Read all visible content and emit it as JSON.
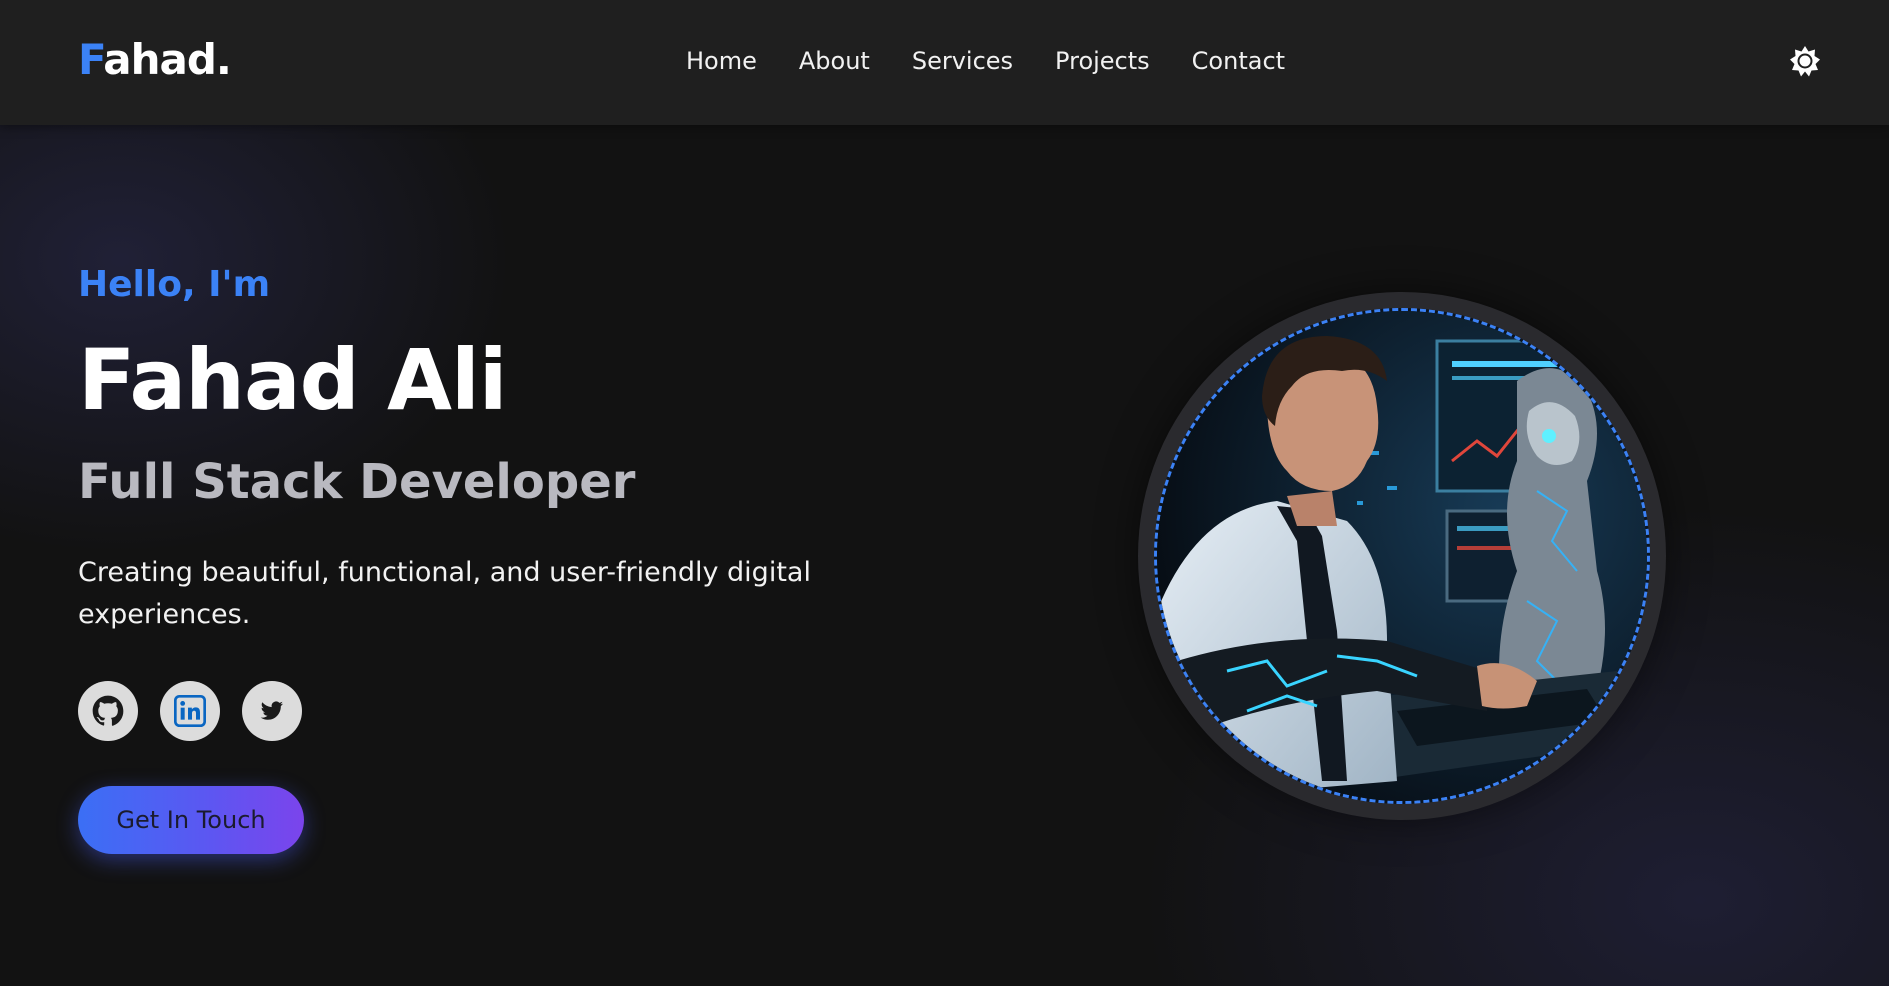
{
  "header": {
    "logo_first": "F",
    "logo_rest": "ahad.",
    "nav": [
      {
        "label": "Home"
      },
      {
        "label": "About"
      },
      {
        "label": "Services"
      },
      {
        "label": "Projects"
      },
      {
        "label": "Contact"
      }
    ],
    "theme_icon": "sun-icon"
  },
  "hero": {
    "greeting": "Hello, I'm",
    "name": "Fahad Ali",
    "role": "Full Stack Developer",
    "description": "Creating beautiful, functional, and user-friendly digital experiences.",
    "socials": [
      {
        "icon": "github-icon"
      },
      {
        "icon": "linkedin-icon"
      },
      {
        "icon": "twitter-icon"
      }
    ],
    "cta_label": "Get In Touch",
    "image_subject": "portrait-illustration"
  },
  "colors": {
    "accent": "#3b82f6",
    "background": "#121212",
    "navbar": "#1f1f1f",
    "role_text": "#b9b9c0",
    "cta_gradient_start": "#3b6ff5",
    "cta_gradient_end": "#7b44ec"
  }
}
